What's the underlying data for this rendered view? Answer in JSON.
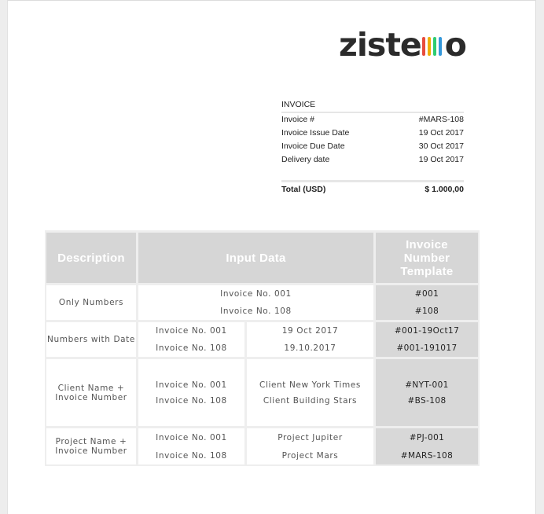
{
  "logo": {
    "text_left": "zist",
    "text_e": "e",
    "text_right": "o",
    "bar_colors": [
      "#e74c3c",
      "#f0ad00",
      "#2ecc71",
      "#3498db"
    ]
  },
  "invoice": {
    "title": "INVOICE",
    "rows": [
      {
        "label": "Invoice #",
        "value": "#MARS-108"
      },
      {
        "label": "Invoice Issue Date",
        "value": "19 Oct 2017"
      },
      {
        "label": "Invoice Due Date",
        "value": "30 Oct 2017"
      },
      {
        "label": "Delivery date",
        "value": "19 Oct 2017"
      }
    ],
    "total_label": "Total (USD)",
    "total_value": "$ 1.000,00"
  },
  "table": {
    "headers": {
      "description": "Description",
      "input_data": "Input Data",
      "template_line1": "Invoice",
      "template_line2": "Number",
      "template_line3": "Template"
    },
    "rows": [
      {
        "desc_line1": "Only Numbers",
        "input_a": [
          "Invoice No. 001",
          "Invoice No. 108"
        ],
        "template": [
          "#001",
          "#108"
        ]
      },
      {
        "desc_line1": "Numbers with Date",
        "input_a": [
          "Invoice No. 001",
          "Invoice No. 108"
        ],
        "input_b": [
          "19 Oct 2017",
          "19.10.2017"
        ],
        "template": [
          "#001-19Oct17",
          "#001-191017"
        ]
      },
      {
        "desc_line1": "Client Name +",
        "desc_line2": "Invoice Number",
        "input_a": [
          "Invoice No. 001",
          "Invoice No. 108"
        ],
        "input_b": [
          "Client New York Times",
          "Client Building Stars"
        ],
        "template": [
          "#NYT-001",
          "#BS-108"
        ]
      },
      {
        "desc_line1": "Project Name +",
        "desc_line2": "Invoice Number",
        "input_a": [
          "Invoice No. 001",
          "Invoice No. 108"
        ],
        "input_b": [
          "Project Jupiter",
          "Project Mars"
        ],
        "template": [
          "#PJ-001",
          "#MARS-108"
        ]
      }
    ]
  }
}
